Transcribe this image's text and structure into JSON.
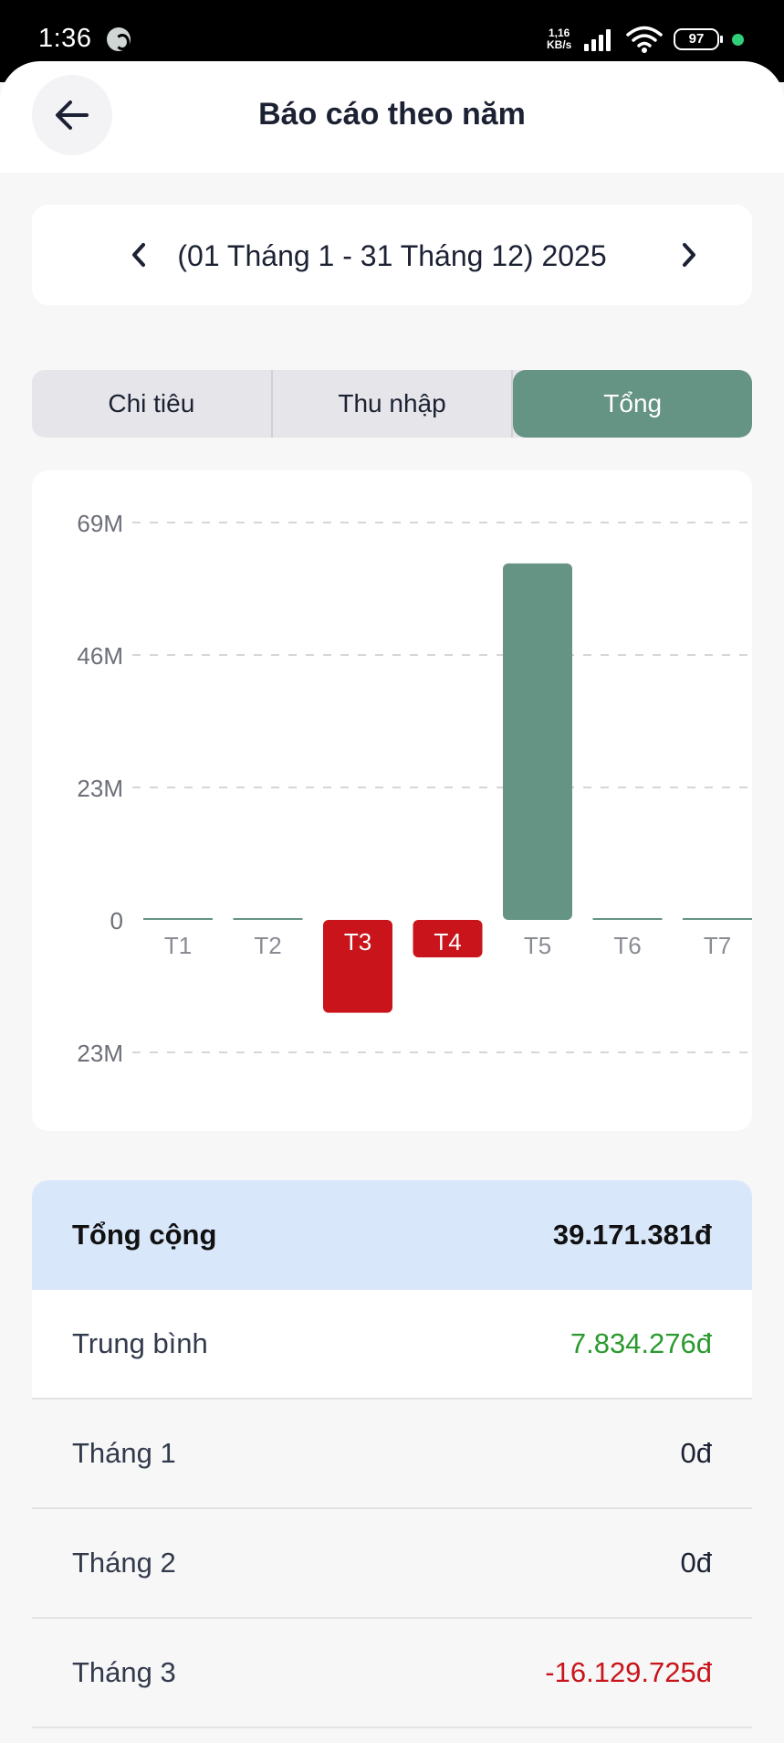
{
  "status_bar": {
    "time": "1:36",
    "net_speed_value": "1,16",
    "net_speed_unit": "KB/s",
    "battery": "97"
  },
  "header": {
    "title": "Báo cáo theo năm"
  },
  "date_range": {
    "label": "(01 Tháng 1 - 31 Tháng 12) 2025"
  },
  "tabs": [
    {
      "label": "Chi tiêu",
      "active": false
    },
    {
      "label": "Thu nhập",
      "active": false
    },
    {
      "label": "Tổng",
      "active": true
    }
  ],
  "chart_data": {
    "type": "bar",
    "categories": [
      "T1",
      "T2",
      "T3",
      "T4",
      "T5",
      "T6",
      "T7"
    ],
    "values": [
      0,
      0,
      -16129725,
      -6500000,
      61900000,
      0,
      0
    ],
    "y_tick_labels": [
      "69M",
      "46M",
      "23M",
      "0",
      "23M"
    ],
    "y_tick_values": [
      69000000,
      46000000,
      23000000,
      0,
      -23000000
    ],
    "ylim": [
      -23000000,
      69000000
    ],
    "grid": true,
    "colors": {
      "positive": "#659384",
      "negative": "#c8141a"
    }
  },
  "summary": {
    "total_label": "Tổng cộng",
    "total_value": "39.171.381đ",
    "average_label": "Trung bình",
    "average_value": "7.834.276đ",
    "months": [
      {
        "label": "Tháng 1",
        "value": "0đ",
        "tone": "neutral"
      },
      {
        "label": "Tháng 2",
        "value": "0đ",
        "tone": "neutral"
      },
      {
        "label": "Tháng 3",
        "value": "-16.129.725đ",
        "tone": "negative"
      }
    ]
  },
  "colors": {
    "accent": "#659384",
    "negative": "#c8141a",
    "positive_text": "#2a9a2e",
    "total_bg": "#d8e7f9"
  }
}
